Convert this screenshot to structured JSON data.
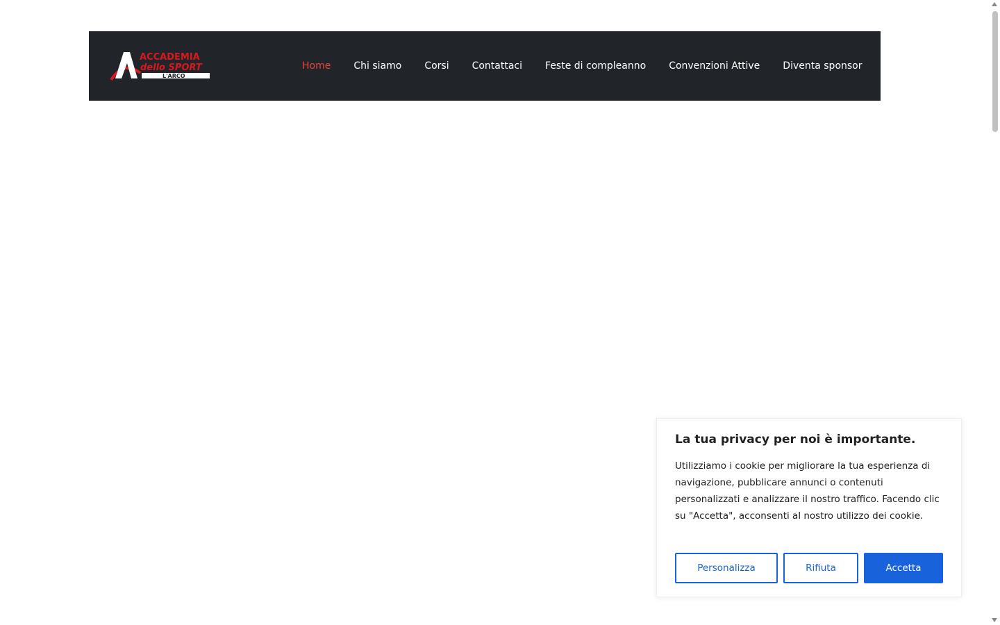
{
  "brand": {
    "logo_line1": "ACCADEMIA",
    "logo_line2": "dello SPORT",
    "logo_line3": "L'ARCO",
    "logo_red": "#d71920",
    "logo_white": "#ffffff"
  },
  "nav": {
    "background": "#212429",
    "active_color": "#e8463a",
    "items": [
      {
        "label": "Home",
        "active": true
      },
      {
        "label": "Chi siamo",
        "active": false
      },
      {
        "label": "Corsi",
        "active": false
      },
      {
        "label": "Contattaci",
        "active": false
      },
      {
        "label": "Feste di compleanno",
        "active": false
      },
      {
        "label": "Convenzioni Attive",
        "active": false
      },
      {
        "label": "Diventa sponsor",
        "active": false
      }
    ]
  },
  "cookie": {
    "title": "La tua privacy per noi è importante.",
    "text": "Utilizziamo i cookie per migliorare la tua esperienza di navigazione, pubblicare annunci o contenuti personalizzati e analizzare il nostro traffico. Facendo clic su \"Accetta\", acconsenti al nostro utilizzo dei cookie.",
    "customize_label": "Personalizza",
    "reject_label": "Rifiuta",
    "accept_label": "Accetta",
    "accent_color": "#1863dc"
  }
}
